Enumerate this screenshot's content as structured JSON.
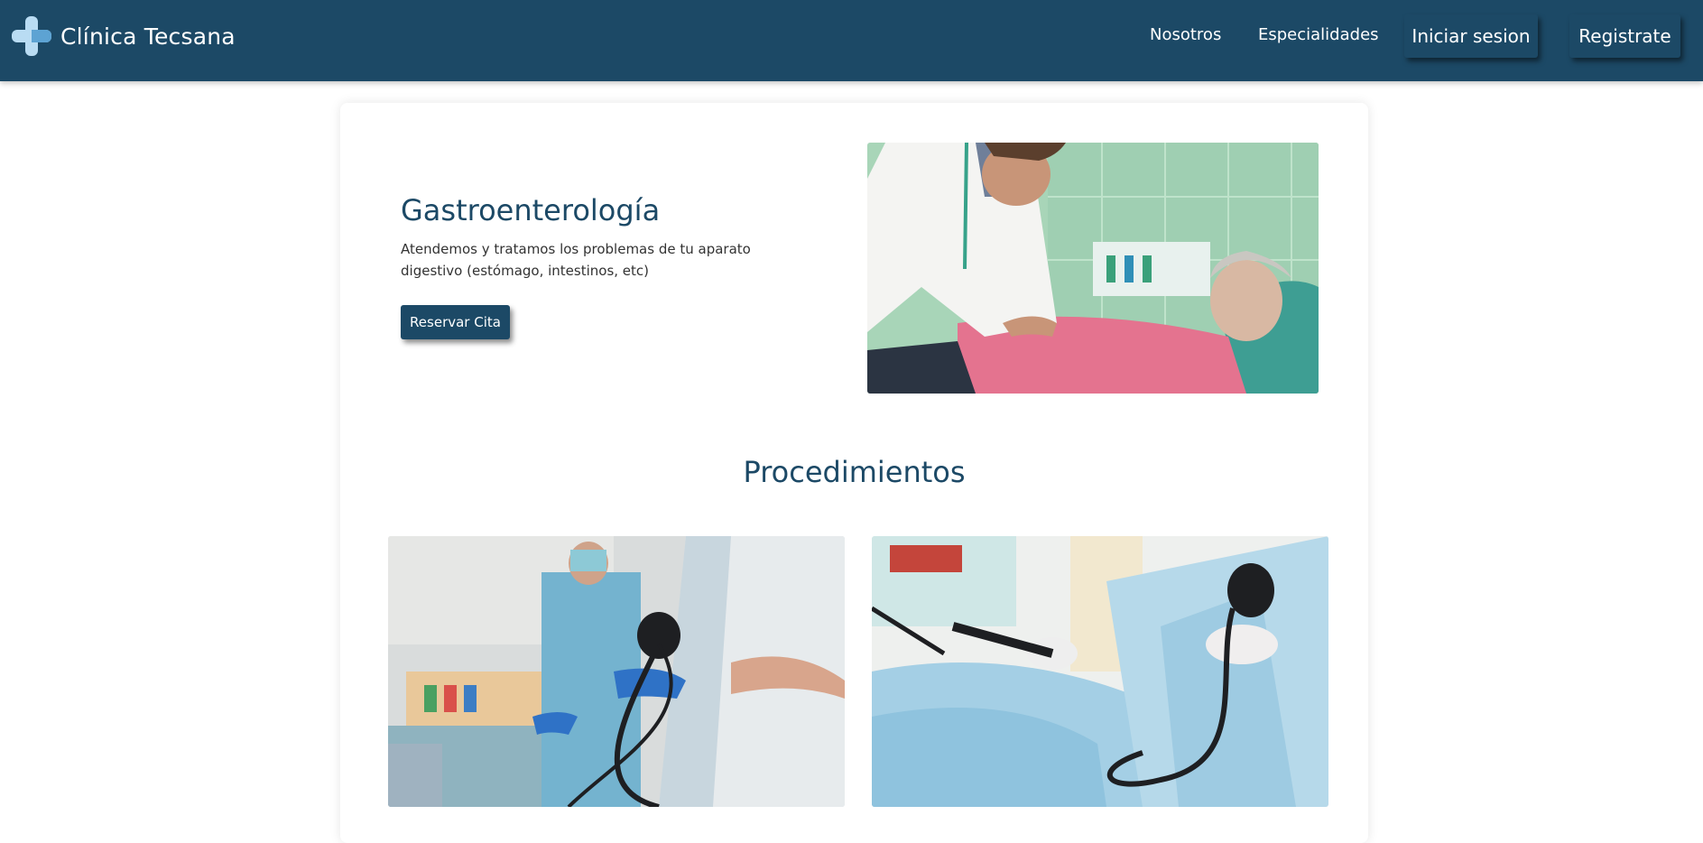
{
  "header": {
    "brand_name": "Clínica Tecsana",
    "nav": {
      "about": "Nosotros",
      "specialties": "Especialidades",
      "login": "Iniciar sesion",
      "register": "Registrate"
    }
  },
  "hero": {
    "title": "Gastroenterología",
    "description": "Atendemos y tratamos los problemas de tu aparato digestivo (estómago, intestinos, etc)",
    "button_label": "Reservar Cita"
  },
  "procedures": {
    "title": "Procedimientos"
  },
  "colors": {
    "primary": "#1c4966",
    "logo_light": "#b9dcf3",
    "logo_accent": "#5da3d3"
  }
}
